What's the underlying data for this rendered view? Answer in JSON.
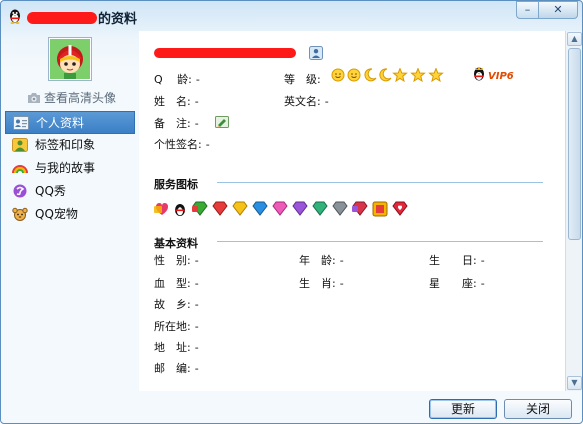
{
  "window": {
    "title_suffix": "的资料",
    "minimize_label": "–",
    "close_label": "✕"
  },
  "left": {
    "hd_avatar_link": "查看高清头像",
    "nav": [
      {
        "label": "个人资料",
        "icon": "profile-card-icon",
        "active": true
      },
      {
        "label": "标签和印象",
        "icon": "user-tag-icon",
        "active": false
      },
      {
        "label": "与我的故事",
        "icon": "rainbow-icon",
        "active": false
      },
      {
        "label": "QQ秀",
        "icon": "qq-show-icon",
        "active": false
      },
      {
        "label": "QQ宠物",
        "icon": "qq-pet-icon",
        "active": false
      }
    ]
  },
  "profile": {
    "qq_age": {
      "label": "Q　 龄:",
      "value": "-"
    },
    "level": {
      "label": "等　级:"
    },
    "vip": "VIP6",
    "real_name": {
      "label": "姓　名:",
      "value": "-"
    },
    "english_name": {
      "label": "英文名:",
      "value": "-"
    },
    "remark": {
      "label": "备　注:",
      "value": "-"
    },
    "signature": {
      "label": "个性签名:",
      "value": "-"
    }
  },
  "service_icons": {
    "title": "服务图标",
    "items": [
      "love-diamond",
      "qq-penguin",
      "green-diamond",
      "red-diamond",
      "yellow-diamond",
      "blue-diamond",
      "pink-diamond",
      "purple-diamond",
      "green-diamond-2",
      "gray-diamond",
      "red-diamond-2",
      "game-diamond",
      "heart-diamond"
    ]
  },
  "basic_info": {
    "title": "基本资料",
    "gender": {
      "label": "性　别:",
      "value": "-"
    },
    "age": {
      "label": "年　龄:",
      "value": "-"
    },
    "birthday": {
      "label": "生　　日:",
      "value": "-"
    },
    "blood": {
      "label": "血　型:",
      "value": "-"
    },
    "zodiac": {
      "label": "生　肖:",
      "value": "-"
    },
    "constellation": {
      "label": "星　　座:",
      "value": "-"
    },
    "hometown": {
      "label": "故　乡:",
      "value": "-"
    },
    "location": {
      "label": "所在地:",
      "value": "-"
    },
    "address": {
      "label": "地　址:",
      "value": "-"
    },
    "zip": {
      "label": "邮　编:",
      "value": "-"
    }
  },
  "buttons": {
    "refresh": "更新",
    "close": "关闭"
  },
  "colors": {
    "accent": "#3b7fc6",
    "redaction": "#ff1a1a",
    "vip": "#e24a00"
  }
}
